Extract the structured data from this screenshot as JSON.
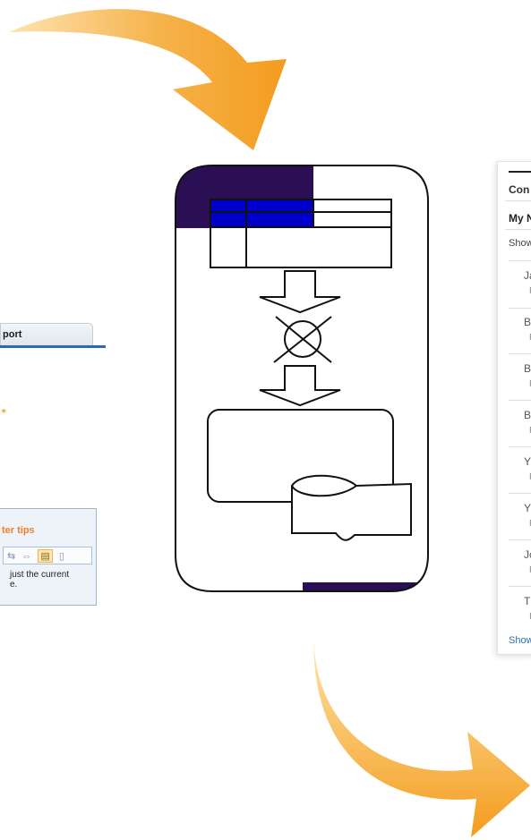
{
  "left_panel": {
    "tab_label": "port",
    "tips_title": "ter tips",
    "toolbar_icons": [
      "⇆",
      "⇔",
      "▤",
      "▯"
    ],
    "tips_text_line1": "just the current",
    "tips_text_line2": "e."
  },
  "right_panel": {
    "header": "Con",
    "section": "My N",
    "show_label": "Show",
    "rows": [
      {
        "initial": "Ja",
        "sub": "F"
      },
      {
        "initial": "B",
        "sub": "F"
      },
      {
        "initial": "B",
        "sub": "F"
      },
      {
        "initial": "B",
        "sub": "F"
      },
      {
        "initial": "Y",
        "sub": "F"
      },
      {
        "initial": "Y",
        "sub": "F"
      },
      {
        "initial": "Jo",
        "sub": "F"
      },
      {
        "initial": "T",
        "sub": "I"
      }
    ],
    "show_more": "Show"
  },
  "colors": {
    "arrow_orange": "#f39c1e",
    "arrow_light": "#fde3b0",
    "dark_purple": "#2a0f55",
    "table_blue": "#0000cc",
    "tips_title": "#f07f2a",
    "tab_underline": "#2f6ba8",
    "link_blue": "#2a6db3"
  },
  "icons": [
    "curved-arrow-top",
    "curved-arrow-bottom",
    "down-arrow-icon",
    "circle-x-icon",
    "database-cylinder-icon",
    "table-icon"
  ]
}
